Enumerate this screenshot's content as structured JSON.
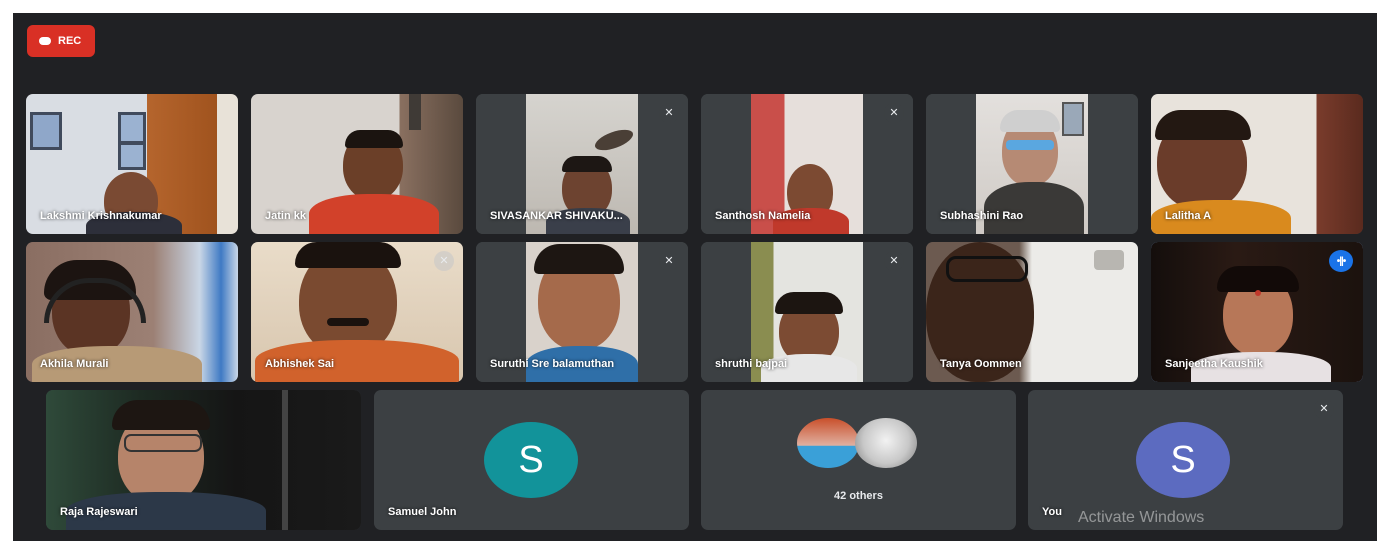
{
  "recording": {
    "label": "REC"
  },
  "participants": [
    {
      "name": "Lakshmi Krishnakumar",
      "muted": false
    },
    {
      "name": "Jatin kk",
      "muted": false
    },
    {
      "name": "SIVASANKAR SHIVAKU...",
      "muted": true
    },
    {
      "name": "Santhosh Namelia",
      "muted": true
    },
    {
      "name": "Subhashini Rao",
      "muted": false
    },
    {
      "name": "Lalitha A",
      "muted": false
    },
    {
      "name": "Akhila Murali",
      "muted": false
    },
    {
      "name": "Abhishek Sai",
      "muted": false
    },
    {
      "name": "Suruthi Sre balamuthan",
      "muted": true
    },
    {
      "name": "shruthi bajpai",
      "muted": true
    },
    {
      "name": "Tanya Oommen",
      "muted": false
    },
    {
      "name": "Sanjeetha Kaushik",
      "muted": false,
      "speaking": true
    },
    {
      "name": "Raja Rajeswari",
      "muted": false
    },
    {
      "name": "Samuel John",
      "avatar_letter": "S",
      "avatar_color": "#12939a",
      "muted": false
    },
    {
      "name": "You",
      "avatar_letter": "S",
      "avatar_color": "#5c6bc0",
      "muted": true
    }
  ],
  "others": {
    "label": "42 others"
  },
  "watermark": {
    "text": "Activate Windows"
  },
  "icons": {
    "mute": "mic-off-icon",
    "speaking": "audio-level-icon",
    "record": "record-dot-icon"
  }
}
